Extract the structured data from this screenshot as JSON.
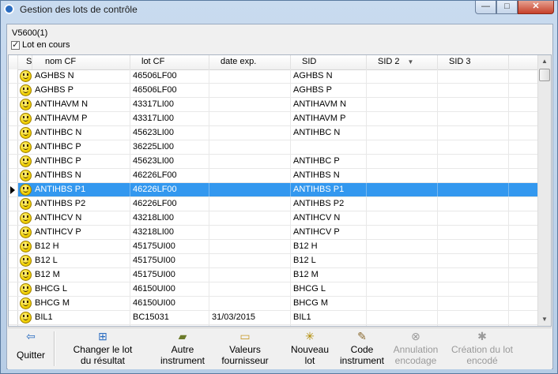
{
  "window": {
    "title": "Gestion des lots de contrôle",
    "min_icon": "minimize-icon",
    "max_icon": "maximize-icon",
    "close_icon": "close-icon",
    "min_glyph": "—",
    "max_glyph": "□",
    "close_glyph": "✕"
  },
  "instrument": {
    "label": "V5600(1)"
  },
  "filter": {
    "lot_en_cours_label": "Lot en cours",
    "checked": true
  },
  "grid": {
    "columns": [
      {
        "key": "s",
        "label": "S"
      },
      {
        "key": "nom_cf",
        "label": "nom CF"
      },
      {
        "key": "lot_cf",
        "label": "lot CF"
      },
      {
        "key": "date_exp",
        "label": "date exp."
      },
      {
        "key": "sid",
        "label": "SID"
      },
      {
        "key": "sid2",
        "label": "SID 2"
      },
      {
        "key": "sid3",
        "label": "SID 3"
      }
    ],
    "sorted_column": "SID 2",
    "rows": [
      {
        "nom": "AGHBS N",
        "lot": "46506LF00",
        "date": "",
        "sid": "AGHBS N",
        "sid2": "",
        "sid3": ""
      },
      {
        "nom": "AGHBS P",
        "lot": "46506LF00",
        "date": "",
        "sid": "AGHBS P",
        "sid2": "",
        "sid3": ""
      },
      {
        "nom": "ANTIHAVM N",
        "lot": "43317LI00",
        "date": "",
        "sid": "ANTIHAVM N",
        "sid2": "",
        "sid3": ""
      },
      {
        "nom": "ANTIHAVM P",
        "lot": "43317LI00",
        "date": "",
        "sid": "ANTIHAVM P",
        "sid2": "",
        "sid3": ""
      },
      {
        "nom": "ANTIHBC N",
        "lot": "45623LI00",
        "date": "",
        "sid": "ANTIHBC N",
        "sid2": "",
        "sid3": ""
      },
      {
        "nom": "ANTIHBC P",
        "lot": "36225LI00",
        "date": "",
        "sid": "",
        "sid2": "",
        "sid3": ""
      },
      {
        "nom": "ANTIHBC P",
        "lot": "45623LI00",
        "date": "",
        "sid": "ANTIHBC P",
        "sid2": "",
        "sid3": ""
      },
      {
        "nom": "ANTIHBS N",
        "lot": "46226LF00",
        "date": "",
        "sid": "ANTIHBS N",
        "sid2": "",
        "sid3": ""
      },
      {
        "nom": "ANTIHBS P1",
        "lot": "46226LF00",
        "date": "",
        "sid": "ANTIHBS P1",
        "sid2": "",
        "sid3": ""
      },
      {
        "nom": "ANTIHBS P2",
        "lot": "46226LF00",
        "date": "",
        "sid": "ANTIHBS P2",
        "sid2": "",
        "sid3": ""
      },
      {
        "nom": "ANTIHCV N",
        "lot": "43218LI00",
        "date": "",
        "sid": "ANTIHCV N",
        "sid2": "",
        "sid3": ""
      },
      {
        "nom": "ANTIHCV P",
        "lot": "43218LI00",
        "date": "",
        "sid": "ANTIHCV P",
        "sid2": "",
        "sid3": ""
      },
      {
        "nom": "B12 H",
        "lot": "45175UI00",
        "date": "",
        "sid": "B12 H",
        "sid2": "",
        "sid3": ""
      },
      {
        "nom": "B12 L",
        "lot": "45175UI00",
        "date": "",
        "sid": "B12 L",
        "sid2": "",
        "sid3": ""
      },
      {
        "nom": "B12 M",
        "lot": "45175UI00",
        "date": "",
        "sid": "B12 M",
        "sid2": "",
        "sid3": ""
      },
      {
        "nom": "BHCG L",
        "lot": "46150UI00",
        "date": "",
        "sid": "BHCG L",
        "sid2": "",
        "sid3": ""
      },
      {
        "nom": "BHCG M",
        "lot": "46150UI00",
        "date": "",
        "sid": "BHCG M",
        "sid2": "",
        "sid3": ""
      },
      {
        "nom": "BIL1",
        "lot": "BC15031",
        "date": "31/03/2015",
        "sid": "BIL1",
        "sid2": "",
        "sid3": ""
      },
      {
        "nom": "",
        "lot": "",
        "date": "",
        "sid": "",
        "sid2": "",
        "sid3": ""
      }
    ],
    "selected_index": 8
  },
  "toolbar": {
    "quitter": "Quitter",
    "changer_lot_1": "Changer le lot",
    "changer_lot_2": "du résultat",
    "autre_instrument_1": "Autre",
    "autre_instrument_2": "instrument",
    "valeurs_fournisseur_1": "Valeurs",
    "valeurs_fournisseur_2": "fournisseur",
    "nouveau_lot_1": "Nouveau",
    "nouveau_lot_2": "lot",
    "code_instrument_1": "Code",
    "code_instrument_2": "instrument",
    "annulation_encodage_1": "Annulation",
    "annulation_encodage_2": "encodage",
    "creation_lot_encode_1": "Création du lot",
    "creation_lot_encode_2": "encodé"
  },
  "icons": {
    "quitter": "arrow-left-icon",
    "changer_lot": "grid-swap-icon",
    "autre_instrument": "folder-arrow-icon",
    "valeurs_fournisseur": "folder-open-icon",
    "nouveau_lot": "new-star-icon",
    "code_instrument": "code-edit-icon",
    "annulation": "cancel-circle-icon",
    "creation": "create-star-icon"
  },
  "icon_glyphs": {
    "quitter": "⇦",
    "changer_lot": "⊞",
    "autre_instrument": "▰",
    "valeurs_fournisseur": "▭",
    "nouveau_lot": "✳",
    "code_instrument": "✎",
    "annulation": "⊗",
    "creation": "✱",
    "sort_desc": "▼",
    "scroll_up": "▲",
    "scroll_down": "▼"
  },
  "colors": {
    "selection": "#3398ef",
    "smiley": "#f2d200",
    "title_bar": "#c9dbef"
  }
}
